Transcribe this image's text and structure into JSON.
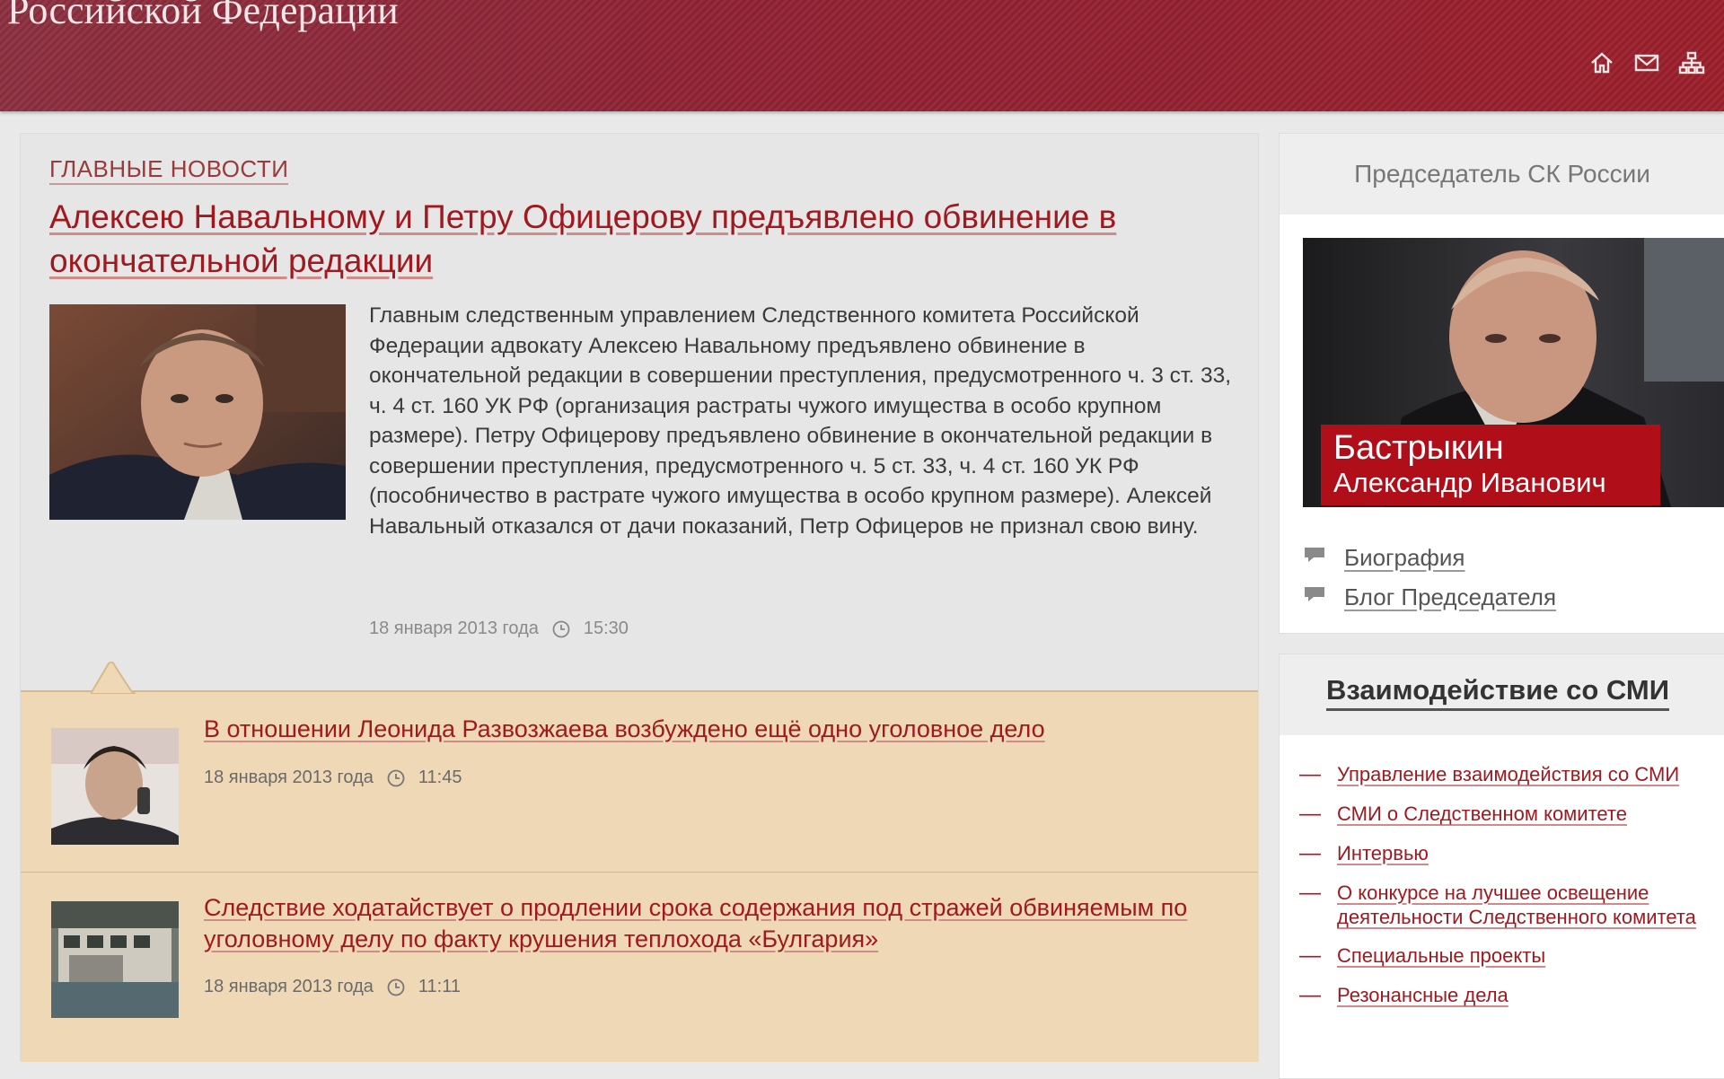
{
  "header": {
    "site_title": "Российской Федерации",
    "icons": [
      "home-icon",
      "mail-icon",
      "sitemap-icon"
    ]
  },
  "main_news": {
    "section_label": "ГЛАВНЫЕ НОВОСТИ",
    "title": "Алексею Навальному и Петру Офицерову предъявлено обвинение в окончательной редакции",
    "text": "Главным следственным управлением Следственного комитета Российской Федерации адвокату Алексею Навальному предъявлено обвинение в окончательной редакции в совершении преступления, предусмотренного ч. 3 ст. 33, ч. 4 ст. 160 УК РФ (организация растраты чужого имущества в особо крупном размере). Петру Офицерову предъявлено обвинение в окончательной редакции в совершении преступления, предусмотренного ч. 5 ст. 33, ч. 4 ст. 160 УК РФ (пособничество в растрате чужого имущества в особо крупном размере). Алексей Навальный отказался от дачи показаний, Петр Офицеров не признал свою вину.",
    "date": "18 января 2013 года",
    "time": "15:30"
  },
  "news_list": [
    {
      "title": "В отношении Леонида Развозжаева возбуждено ещё одно уголовное дело",
      "date": "18 января 2013 года",
      "time": "11:45"
    },
    {
      "title": "Следствие ходатайствует о продлении срока содержания под стражей обвиняемым по уголовному делу по факту крушения теплохода «Булгария»",
      "date": "18 января 2013 года",
      "time": "11:11"
    }
  ],
  "chairman": {
    "heading": "Председатель СК России",
    "surname": "Бастрыкин",
    "name": "Александр Иванович",
    "links": [
      "Биография",
      "Блог Председателя"
    ]
  },
  "media": {
    "heading": "Взаимодействие со СМИ",
    "links": [
      "Управление взаимодействия со СМИ",
      "СМИ о Следственном комитете",
      "Интервью",
      "О конкурсе на лучшее освещение деятельности Следственного комитета",
      "Специальные проекты",
      "Резонансные дела"
    ]
  },
  "colors": {
    "header": "#8e2133",
    "link": "#a0191f",
    "news_list_bg": "#efd8b5",
    "name_plate": "#b00f1a"
  }
}
